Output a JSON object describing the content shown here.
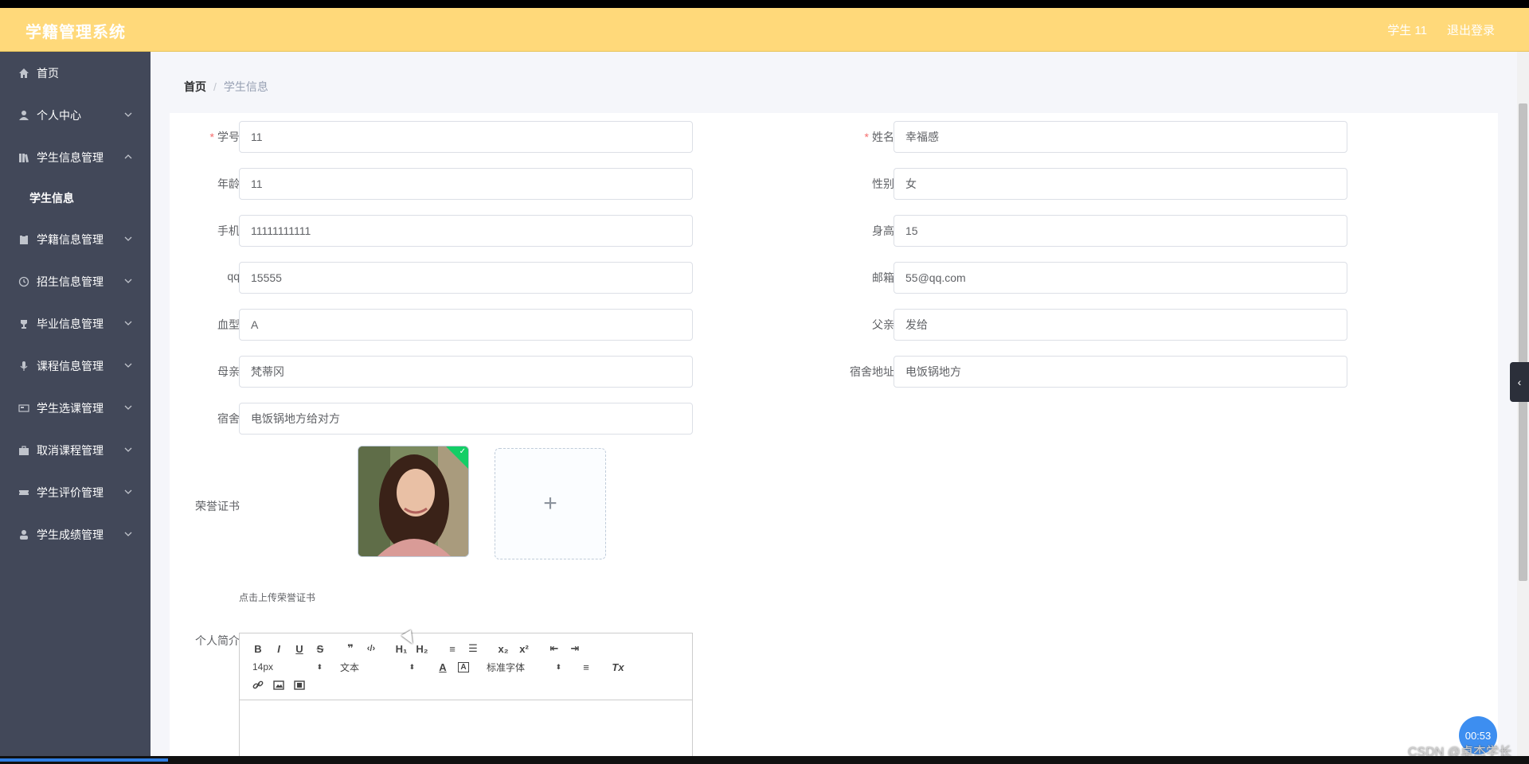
{
  "app": {
    "title": "学籍管理系统"
  },
  "header": {
    "user": "学生 11",
    "logout": "退出登录"
  },
  "sidebar": {
    "items": [
      {
        "label": "首页",
        "icon": "home-icon"
      },
      {
        "label": "个人中心",
        "icon": "user-icon"
      },
      {
        "label": "学生信息管理",
        "icon": "book-icon",
        "expanded": true,
        "children": [
          {
            "label": "学生信息"
          }
        ]
      },
      {
        "label": "学籍信息管理",
        "icon": "clipboard-icon"
      },
      {
        "label": "招生信息管理",
        "icon": "clock-icon"
      },
      {
        "label": "毕业信息管理",
        "icon": "trophy-icon"
      },
      {
        "label": "课程信息管理",
        "icon": "microphone-icon"
      },
      {
        "label": "学生选课管理",
        "icon": "card-icon"
      },
      {
        "label": "取消课程管理",
        "icon": "briefcase-icon"
      },
      {
        "label": "学生评价管理",
        "icon": "ticket-icon"
      },
      {
        "label": "学生成绩管理",
        "icon": "person-icon"
      }
    ]
  },
  "breadcrumb": {
    "home": "首页",
    "separator": "/",
    "current": "学生信息"
  },
  "form": {
    "student_id": {
      "label": "学号",
      "value": "11",
      "required": true
    },
    "name": {
      "label": "姓名",
      "value": "幸福感",
      "required": true
    },
    "age": {
      "label": "年龄",
      "value": "11"
    },
    "gender": {
      "label": "性别",
      "value": "女"
    },
    "phone": {
      "label": "手机",
      "value": "11111111111"
    },
    "height": {
      "label": "身高",
      "value": "15"
    },
    "qq": {
      "label": "qq",
      "value": "15555"
    },
    "email": {
      "label": "邮箱",
      "value": "55@qq.com"
    },
    "blood_type": {
      "label": "血型",
      "value": "A"
    },
    "father": {
      "label": "父亲",
      "value": "发给"
    },
    "mother": {
      "label": "母亲",
      "value": "梵蒂冈"
    },
    "dorm_address": {
      "label": "宿舍地址",
      "value": "电饭锅地方"
    },
    "dorm": {
      "label": "宿舍",
      "value": "电饭锅地方给对方"
    },
    "certificate": {
      "label": "荣誉证书",
      "add_symbol": "+",
      "tip": "点击上传荣誉证书"
    },
    "intro": {
      "label": "个人简介"
    }
  },
  "editor": {
    "row1": [
      "B",
      "I",
      "U",
      "S",
      "❞",
      "‹/›",
      "H₁",
      "H₂",
      "≡",
      "☰",
      "x₂",
      "x²",
      "⇤",
      "⇥"
    ],
    "size_select": "14px",
    "header_select": "文本",
    "font_select": "标准字体",
    "color_btn": "A",
    "bg_btn": "A",
    "align_btn": "≡",
    "clean_btn": "Tx",
    "row3": [
      "🔗",
      "▣",
      "▤"
    ]
  },
  "overlay": {
    "timer": "00:53",
    "watermark": "CSDN @卓杰学长",
    "side_tab": "‹"
  },
  "colors": {
    "header": "#ffd97a",
    "sidebar": "#424859",
    "required": "#f56c6c",
    "upload_success": "#13ce66"
  },
  "video_progress": 0.11
}
